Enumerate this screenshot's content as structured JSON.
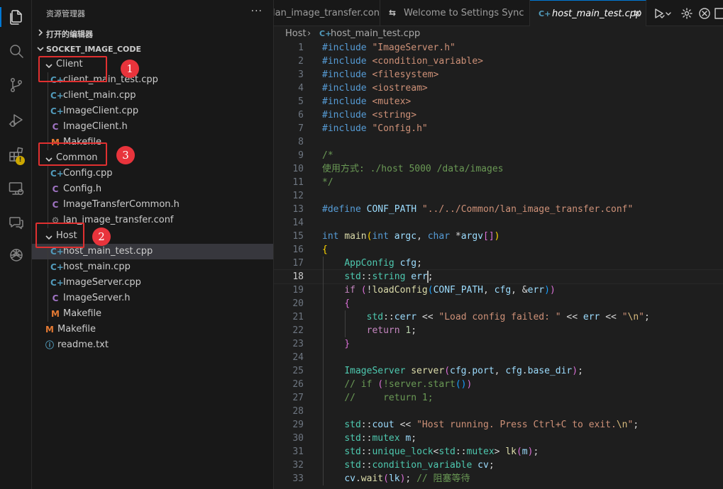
{
  "sidebar": {
    "title": "资源管理器",
    "more": "···",
    "open_editors": "打开的编辑器",
    "workspace": "SOCKET_IMAGE_CODE",
    "tree": [
      {
        "label": "Client",
        "type": "folder"
      },
      {
        "label": "client_main_test.cpp",
        "type": "cpp"
      },
      {
        "label": "client_main.cpp",
        "type": "cpp"
      },
      {
        "label": "ImageClient.cpp",
        "type": "cpp"
      },
      {
        "label": "ImageClient.h",
        "type": "h"
      },
      {
        "label": "Makefile",
        "type": "make"
      },
      {
        "label": "Common",
        "type": "folder"
      },
      {
        "label": "Config.cpp",
        "type": "cpp"
      },
      {
        "label": "Config.h",
        "type": "h"
      },
      {
        "label": "ImageTransferCommon.h",
        "type": "h"
      },
      {
        "label": "lan_image_transfer.conf",
        "type": "conf"
      },
      {
        "label": "Host",
        "type": "folder"
      },
      {
        "label": "host_main_test.cpp",
        "type": "cpp"
      },
      {
        "label": "host_main.cpp",
        "type": "cpp"
      },
      {
        "label": "ImageServer.cpp",
        "type": "cpp"
      },
      {
        "label": "ImageServer.h",
        "type": "h"
      },
      {
        "label": "Makefile",
        "type": "make"
      },
      {
        "label": "Makefile",
        "type": "make"
      },
      {
        "label": "readme.txt",
        "type": "info"
      }
    ],
    "icon_glyphs": {
      "cpp": "C+",
      "h": "C",
      "make": "M",
      "conf": "⚙",
      "info": "ⓘ"
    }
  },
  "annotations": [
    "1",
    "2",
    "3"
  ],
  "annotation_color": "#e03030",
  "tabs": [
    {
      "label": "lan_image_transfer.conf",
      "icon": "gear-icon"
    },
    {
      "label": "Welcome to Settings Sync",
      "icon": "sync-icon"
    },
    {
      "label": "host_main_test.cpp",
      "icon": "cpp-file-icon",
      "close": "✕"
    }
  ],
  "breadcrumb": {
    "folder": "Host",
    "sep": "›",
    "file": "host_main_test.cpp"
  },
  "editor": {
    "line_numbers": [
      "1",
      "2",
      "3",
      "4",
      "5",
      "6",
      "7",
      "8",
      "9",
      "10",
      "11",
      "12",
      "13",
      "14",
      "15",
      "16",
      "17",
      "18",
      "19",
      "20",
      "21",
      "22",
      "23",
      "24",
      "25",
      "26",
      "27",
      "28",
      "29",
      "30",
      "31",
      "32",
      "33"
    ],
    "current_line": "18",
    "lines": [
      [
        [
          "m",
          "#include "
        ],
        [
          "s",
          "\"ImageServer.h\""
        ]
      ],
      [
        [
          "m",
          "#include "
        ],
        [
          "s",
          "<condition_variable>"
        ]
      ],
      [
        [
          "m",
          "#include "
        ],
        [
          "s",
          "<filesystem>"
        ]
      ],
      [
        [
          "m",
          "#include "
        ],
        [
          "s",
          "<iostream>"
        ]
      ],
      [
        [
          "m",
          "#include "
        ],
        [
          "s",
          "<mutex>"
        ]
      ],
      [
        [
          "m",
          "#include "
        ],
        [
          "s",
          "<string>"
        ]
      ],
      [
        [
          "m",
          "#include "
        ],
        [
          "s",
          "\"Config.h\""
        ]
      ],
      [],
      [
        [
          "c",
          "/*"
        ]
      ],
      [
        [
          "c",
          "使用方式: ./host 5000 /data/images"
        ]
      ],
      [
        [
          "c",
          "*/"
        ]
      ],
      [],
      [
        [
          "m",
          "#define "
        ],
        [
          "v",
          "CONF_PATH "
        ],
        [
          "s",
          "\"../../Common/lan_image_transfer.conf\""
        ]
      ],
      [],
      [
        [
          "k",
          "int "
        ],
        [
          "f",
          "main"
        ],
        [
          "b1",
          "("
        ],
        [
          "k",
          "int "
        ],
        [
          "v",
          "argc"
        ],
        [
          "p",
          ", "
        ],
        [
          "k",
          "char "
        ],
        [
          "p",
          "*"
        ],
        [
          "v",
          "argv"
        ],
        [
          "b2",
          "[]"
        ],
        [
          "b1",
          ")"
        ]
      ],
      [
        [
          "b1",
          "{"
        ]
      ],
      [
        [
          "p",
          "    "
        ],
        [
          "t",
          "AppConfig "
        ],
        [
          "v",
          "cfg"
        ],
        [
          "p",
          ";"
        ]
      ],
      [
        [
          "p",
          "    "
        ],
        [
          "t",
          "std"
        ],
        [
          "p",
          "::"
        ],
        [
          "t",
          "string "
        ],
        [
          "v",
          "err"
        ],
        [
          "p",
          ";"
        ]
      ],
      [
        [
          "p",
          "    "
        ],
        [
          "kc",
          "if "
        ],
        [
          "b2",
          "("
        ],
        [
          "p",
          "!"
        ],
        [
          "f",
          "loadConfig"
        ],
        [
          "b3",
          "("
        ],
        [
          "v",
          "CONF_PATH"
        ],
        [
          "p",
          ", "
        ],
        [
          "v",
          "cfg"
        ],
        [
          "p",
          ", &"
        ],
        [
          "v",
          "err"
        ],
        [
          "b3",
          ")"
        ],
        [
          "b2",
          ")"
        ]
      ],
      [
        [
          "p",
          "    "
        ],
        [
          "b2",
          "{"
        ]
      ],
      [
        [
          "p",
          "        "
        ],
        [
          "t",
          "std"
        ],
        [
          "p",
          "::"
        ],
        [
          "v",
          "cerr "
        ],
        [
          "p",
          "<< "
        ],
        [
          "s",
          "\"Load config failed: \" "
        ],
        [
          "p",
          "<< "
        ],
        [
          "v",
          "err "
        ],
        [
          "p",
          "<< "
        ],
        [
          "s",
          "\""
        ],
        [
          "esc",
          "\\n"
        ],
        [
          "s",
          "\""
        ],
        [
          "p",
          ";"
        ]
      ],
      [
        [
          "p",
          "        "
        ],
        [
          "kc",
          "return "
        ],
        [
          "n",
          "1"
        ],
        [
          "p",
          ";"
        ]
      ],
      [
        [
          "p",
          "    "
        ],
        [
          "b2",
          "}"
        ]
      ],
      [],
      [
        [
          "p",
          "    "
        ],
        [
          "t",
          "ImageServer "
        ],
        [
          "f",
          "server"
        ],
        [
          "b2",
          "("
        ],
        [
          "v",
          "cfg"
        ],
        [
          "p",
          "."
        ],
        [
          "v",
          "port"
        ],
        [
          "p",
          ", "
        ],
        [
          "v",
          "cfg"
        ],
        [
          "p",
          "."
        ],
        [
          "v",
          "base_dir"
        ],
        [
          "b2",
          ")"
        ],
        [
          "p",
          ";"
        ]
      ],
      [
        [
          "p",
          "    "
        ],
        [
          "c",
          "// if "
        ],
        [
          "b2",
          "("
        ],
        [
          "c",
          "!server.start"
        ],
        [
          "b3",
          "()"
        ],
        [
          "b2",
          ")"
        ]
      ],
      [
        [
          "p",
          "    "
        ],
        [
          "c",
          "//     return 1;"
        ]
      ],
      [],
      [
        [
          "p",
          "    "
        ],
        [
          "t",
          "std"
        ],
        [
          "p",
          "::"
        ],
        [
          "v",
          "cout "
        ],
        [
          "p",
          "<< "
        ],
        [
          "s",
          "\"Host running. Press Ctrl+C to exit."
        ],
        [
          "esc",
          "\\n"
        ],
        [
          "s",
          "\""
        ],
        [
          "p",
          ";"
        ]
      ],
      [
        [
          "p",
          "    "
        ],
        [
          "t",
          "std"
        ],
        [
          "p",
          "::"
        ],
        [
          "t",
          "mutex "
        ],
        [
          "v",
          "m"
        ],
        [
          "p",
          ";"
        ]
      ],
      [
        [
          "p",
          "    "
        ],
        [
          "t",
          "std"
        ],
        [
          "p",
          "::"
        ],
        [
          "t",
          "unique_lock"
        ],
        [
          "p",
          "<"
        ],
        [
          "t",
          "std"
        ],
        [
          "p",
          "::"
        ],
        [
          "t",
          "mutex"
        ],
        [
          "p",
          "> "
        ],
        [
          "f",
          "lk"
        ],
        [
          "b2",
          "("
        ],
        [
          "v",
          "m"
        ],
        [
          "b2",
          ")"
        ],
        [
          "p",
          ";"
        ]
      ],
      [
        [
          "p",
          "    "
        ],
        [
          "t",
          "std"
        ],
        [
          "p",
          "::"
        ],
        [
          "t",
          "condition_variable "
        ],
        [
          "v",
          "cv"
        ],
        [
          "p",
          ";"
        ]
      ],
      [
        [
          "p",
          "    "
        ],
        [
          "v",
          "cv"
        ],
        [
          "p",
          "."
        ],
        [
          "f",
          "wait"
        ],
        [
          "b2",
          "("
        ],
        [
          "v",
          "lk"
        ],
        [
          "b2",
          ")"
        ],
        [
          "p",
          "; "
        ],
        [
          "c",
          "// 阻塞等待"
        ]
      ]
    ]
  }
}
